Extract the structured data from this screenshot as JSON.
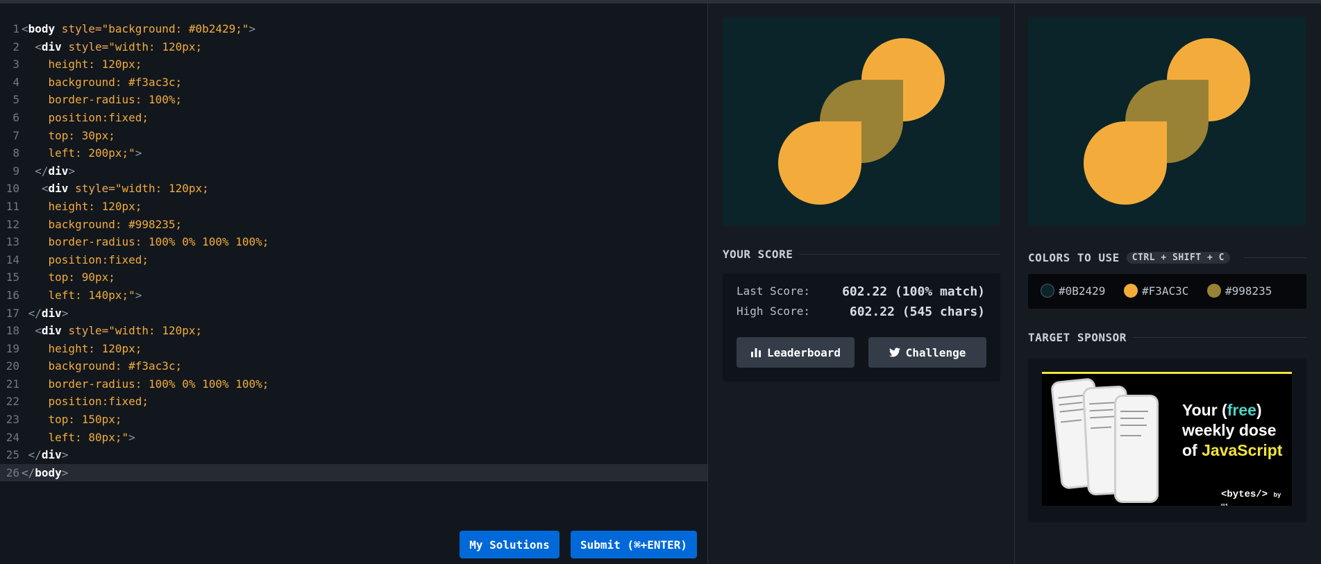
{
  "editor": {
    "lines": [
      {
        "n": "1",
        "segs": [
          {
            "c": "punc",
            "t": "<"
          },
          {
            "c": "tag",
            "t": "body"
          },
          {
            "c": "attr",
            "t": " style="
          },
          {
            "c": "str",
            "t": "\"background: #0b2429;\""
          },
          {
            "c": "punc",
            "t": ">"
          }
        ]
      },
      {
        "n": "2",
        "segs": [
          {
            "c": "punc",
            "t": "  <"
          },
          {
            "c": "tag",
            "t": "div"
          },
          {
            "c": "attr",
            "t": " style="
          },
          {
            "c": "str",
            "t": "\"width: 120px;"
          }
        ]
      },
      {
        "n": "3",
        "segs": [
          {
            "c": "str",
            "t": "    height: 120px;"
          }
        ]
      },
      {
        "n": "4",
        "segs": [
          {
            "c": "str",
            "t": "    background: #f3ac3c;"
          }
        ]
      },
      {
        "n": "5",
        "segs": [
          {
            "c": "str",
            "t": "    border-radius: 100%;"
          }
        ]
      },
      {
        "n": "6",
        "segs": [
          {
            "c": "str",
            "t": "    position:fixed;"
          }
        ]
      },
      {
        "n": "7",
        "segs": [
          {
            "c": "str",
            "t": "    top: 30px;"
          }
        ]
      },
      {
        "n": "8",
        "segs": [
          {
            "c": "str",
            "t": "    left: 200px;\""
          },
          {
            "c": "punc",
            "t": ">"
          }
        ]
      },
      {
        "n": "9",
        "segs": [
          {
            "c": "punc",
            "t": "  </"
          },
          {
            "c": "tag",
            "t": "div"
          },
          {
            "c": "punc",
            "t": ">"
          }
        ]
      },
      {
        "n": "10",
        "segs": [
          {
            "c": "punc",
            "t": "   <"
          },
          {
            "c": "tag",
            "t": "div"
          },
          {
            "c": "attr",
            "t": " style="
          },
          {
            "c": "str",
            "t": "\"width: 120px;"
          }
        ]
      },
      {
        "n": "11",
        "segs": [
          {
            "c": "str",
            "t": "    height: 120px;"
          }
        ]
      },
      {
        "n": "12",
        "segs": [
          {
            "c": "str",
            "t": "    background: #998235;"
          }
        ]
      },
      {
        "n": "13",
        "segs": [
          {
            "c": "str",
            "t": "    border-radius: 100% 0% 100% 100%;"
          }
        ]
      },
      {
        "n": "14",
        "segs": [
          {
            "c": "str",
            "t": "    position:fixed;"
          }
        ]
      },
      {
        "n": "15",
        "segs": [
          {
            "c": "str",
            "t": "    top: 90px;"
          }
        ]
      },
      {
        "n": "16",
        "segs": [
          {
            "c": "str",
            "t": "    left: 140px;\""
          },
          {
            "c": "punc",
            "t": ">"
          }
        ]
      },
      {
        "n": "17",
        "segs": [
          {
            "c": "punc",
            "t": " </"
          },
          {
            "c": "tag",
            "t": "div"
          },
          {
            "c": "punc",
            "t": ">"
          }
        ]
      },
      {
        "n": "18",
        "segs": [
          {
            "c": "punc",
            "t": "  <"
          },
          {
            "c": "tag",
            "t": "div"
          },
          {
            "c": "attr",
            "t": " style="
          },
          {
            "c": "str",
            "t": "\"width: 120px;"
          }
        ]
      },
      {
        "n": "19",
        "segs": [
          {
            "c": "str",
            "t": "    height: 120px;"
          }
        ]
      },
      {
        "n": "20",
        "segs": [
          {
            "c": "str",
            "t": "    background: #f3ac3c;"
          }
        ]
      },
      {
        "n": "21",
        "segs": [
          {
            "c": "str",
            "t": "    border-radius: 100% 0% 100% 100%;"
          }
        ]
      },
      {
        "n": "22",
        "segs": [
          {
            "c": "str",
            "t": "    position:fixed;"
          }
        ]
      },
      {
        "n": "23",
        "segs": [
          {
            "c": "str",
            "t": "    top: 150px;"
          }
        ]
      },
      {
        "n": "24",
        "segs": [
          {
            "c": "str",
            "t": "    left: 80px;\""
          },
          {
            "c": "punc",
            "t": ">"
          }
        ]
      },
      {
        "n": "25",
        "segs": [
          {
            "c": "punc",
            "t": " </"
          },
          {
            "c": "tag",
            "t": "div"
          },
          {
            "c": "punc",
            "t": ">"
          }
        ]
      },
      {
        "n": "26",
        "segs": [
          {
            "c": "punc",
            "t": "</"
          },
          {
            "c": "tag",
            "t": "body"
          },
          {
            "c": "punc",
            "t": ">"
          }
        ]
      }
    ],
    "active_line": "26",
    "my_solutions_label": "My Solutions",
    "submit_label": "Submit (⌘+ENTER)"
  },
  "score": {
    "section_title": "YOUR SCORE",
    "last_label": "Last Score:",
    "last_value": "602.22 (100% match)",
    "high_label": "High Score:",
    "high_value": "602.22 (545 chars)",
    "leaderboard_label": "Leaderboard",
    "challenge_label": "Challenge",
    "leaderboard_icon": "bar-chart-icon",
    "challenge_icon": "twitter-icon"
  },
  "colors": {
    "section_title": "COLORS TO USE",
    "shortcut": "CTRL + SHIFT + C",
    "items": [
      {
        "label": "#0B2429",
        "hex": "#0b2429"
      },
      {
        "label": "#F3AC3C",
        "hex": "#f3ac3c"
      },
      {
        "label": "#998235",
        "hex": "#998235"
      }
    ]
  },
  "sponsor": {
    "section_title": "TARGET SPONSOR",
    "ad_line1_a": "Your (",
    "ad_line1_b": "free",
    "ad_line1_c": ")",
    "ad_line2": "weekly dose",
    "ad_line3_a": "of ",
    "ad_line3_b": "JavaScript",
    "brand": "<bytes/>",
    "brand_suffix": "by Ui"
  },
  "theme": {
    "background": "#0b2429",
    "gold": "#f3ac3c",
    "olive": "#998235",
    "accent_button": "#0069d9"
  }
}
